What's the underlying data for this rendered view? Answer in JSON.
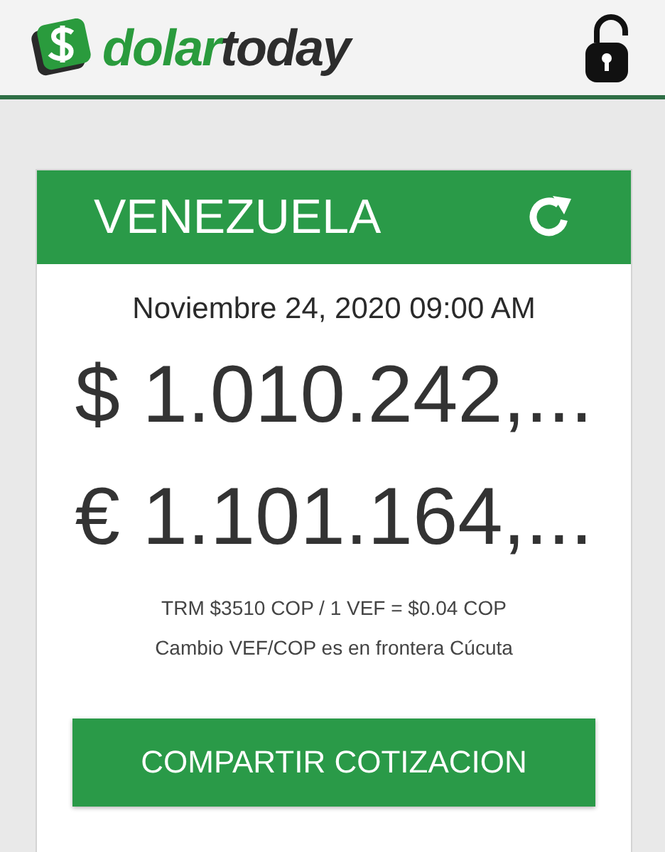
{
  "header": {
    "logo": [
      {
        "text": "dolar",
        "kind": "accent"
      },
      {
        "text": "today",
        "kind": "plain"
      }
    ],
    "locked": false
  },
  "card": {
    "title": "VENEZUELA",
    "date": "Noviembre 24, 2020 09:00 AM",
    "prices": [
      {
        "text": "$ 1.010.242,..."
      },
      {
        "text": "€ 1.101.164,..."
      }
    ],
    "notes": [
      "TRM $3510 COP / 1 VEF = $0.04 COP",
      "Cambio VEF/COP es en frontera Cúcuta"
    ],
    "button": "COMPARTIR COTIZACION"
  }
}
